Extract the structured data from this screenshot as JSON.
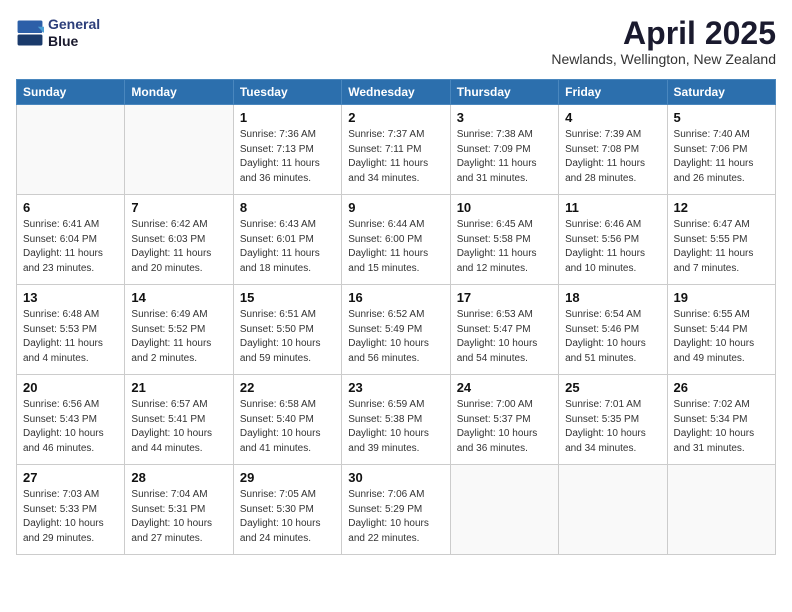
{
  "header": {
    "logo_line1": "General",
    "logo_line2": "Blue",
    "month": "April 2025",
    "location": "Newlands, Wellington, New Zealand"
  },
  "weekdays": [
    "Sunday",
    "Monday",
    "Tuesday",
    "Wednesday",
    "Thursday",
    "Friday",
    "Saturday"
  ],
  "weeks": [
    [
      {
        "day": "",
        "info": ""
      },
      {
        "day": "",
        "info": ""
      },
      {
        "day": "1",
        "info": "Sunrise: 7:36 AM\nSunset: 7:13 PM\nDaylight: 11 hours and 36 minutes."
      },
      {
        "day": "2",
        "info": "Sunrise: 7:37 AM\nSunset: 7:11 PM\nDaylight: 11 hours and 34 minutes."
      },
      {
        "day": "3",
        "info": "Sunrise: 7:38 AM\nSunset: 7:09 PM\nDaylight: 11 hours and 31 minutes."
      },
      {
        "day": "4",
        "info": "Sunrise: 7:39 AM\nSunset: 7:08 PM\nDaylight: 11 hours and 28 minutes."
      },
      {
        "day": "5",
        "info": "Sunrise: 7:40 AM\nSunset: 7:06 PM\nDaylight: 11 hours and 26 minutes."
      }
    ],
    [
      {
        "day": "6",
        "info": "Sunrise: 6:41 AM\nSunset: 6:04 PM\nDaylight: 11 hours and 23 minutes."
      },
      {
        "day": "7",
        "info": "Sunrise: 6:42 AM\nSunset: 6:03 PM\nDaylight: 11 hours and 20 minutes."
      },
      {
        "day": "8",
        "info": "Sunrise: 6:43 AM\nSunset: 6:01 PM\nDaylight: 11 hours and 18 minutes."
      },
      {
        "day": "9",
        "info": "Sunrise: 6:44 AM\nSunset: 6:00 PM\nDaylight: 11 hours and 15 minutes."
      },
      {
        "day": "10",
        "info": "Sunrise: 6:45 AM\nSunset: 5:58 PM\nDaylight: 11 hours and 12 minutes."
      },
      {
        "day": "11",
        "info": "Sunrise: 6:46 AM\nSunset: 5:56 PM\nDaylight: 11 hours and 10 minutes."
      },
      {
        "day": "12",
        "info": "Sunrise: 6:47 AM\nSunset: 5:55 PM\nDaylight: 11 hours and 7 minutes."
      }
    ],
    [
      {
        "day": "13",
        "info": "Sunrise: 6:48 AM\nSunset: 5:53 PM\nDaylight: 11 hours and 4 minutes."
      },
      {
        "day": "14",
        "info": "Sunrise: 6:49 AM\nSunset: 5:52 PM\nDaylight: 11 hours and 2 minutes."
      },
      {
        "day": "15",
        "info": "Sunrise: 6:51 AM\nSunset: 5:50 PM\nDaylight: 10 hours and 59 minutes."
      },
      {
        "day": "16",
        "info": "Sunrise: 6:52 AM\nSunset: 5:49 PM\nDaylight: 10 hours and 56 minutes."
      },
      {
        "day": "17",
        "info": "Sunrise: 6:53 AM\nSunset: 5:47 PM\nDaylight: 10 hours and 54 minutes."
      },
      {
        "day": "18",
        "info": "Sunrise: 6:54 AM\nSunset: 5:46 PM\nDaylight: 10 hours and 51 minutes."
      },
      {
        "day": "19",
        "info": "Sunrise: 6:55 AM\nSunset: 5:44 PM\nDaylight: 10 hours and 49 minutes."
      }
    ],
    [
      {
        "day": "20",
        "info": "Sunrise: 6:56 AM\nSunset: 5:43 PM\nDaylight: 10 hours and 46 minutes."
      },
      {
        "day": "21",
        "info": "Sunrise: 6:57 AM\nSunset: 5:41 PM\nDaylight: 10 hours and 44 minutes."
      },
      {
        "day": "22",
        "info": "Sunrise: 6:58 AM\nSunset: 5:40 PM\nDaylight: 10 hours and 41 minutes."
      },
      {
        "day": "23",
        "info": "Sunrise: 6:59 AM\nSunset: 5:38 PM\nDaylight: 10 hours and 39 minutes."
      },
      {
        "day": "24",
        "info": "Sunrise: 7:00 AM\nSunset: 5:37 PM\nDaylight: 10 hours and 36 minutes."
      },
      {
        "day": "25",
        "info": "Sunrise: 7:01 AM\nSunset: 5:35 PM\nDaylight: 10 hours and 34 minutes."
      },
      {
        "day": "26",
        "info": "Sunrise: 7:02 AM\nSunset: 5:34 PM\nDaylight: 10 hours and 31 minutes."
      }
    ],
    [
      {
        "day": "27",
        "info": "Sunrise: 7:03 AM\nSunset: 5:33 PM\nDaylight: 10 hours and 29 minutes."
      },
      {
        "day": "28",
        "info": "Sunrise: 7:04 AM\nSunset: 5:31 PM\nDaylight: 10 hours and 27 minutes."
      },
      {
        "day": "29",
        "info": "Sunrise: 7:05 AM\nSunset: 5:30 PM\nDaylight: 10 hours and 24 minutes."
      },
      {
        "day": "30",
        "info": "Sunrise: 7:06 AM\nSunset: 5:29 PM\nDaylight: 10 hours and 22 minutes."
      },
      {
        "day": "",
        "info": ""
      },
      {
        "day": "",
        "info": ""
      },
      {
        "day": "",
        "info": ""
      }
    ]
  ]
}
